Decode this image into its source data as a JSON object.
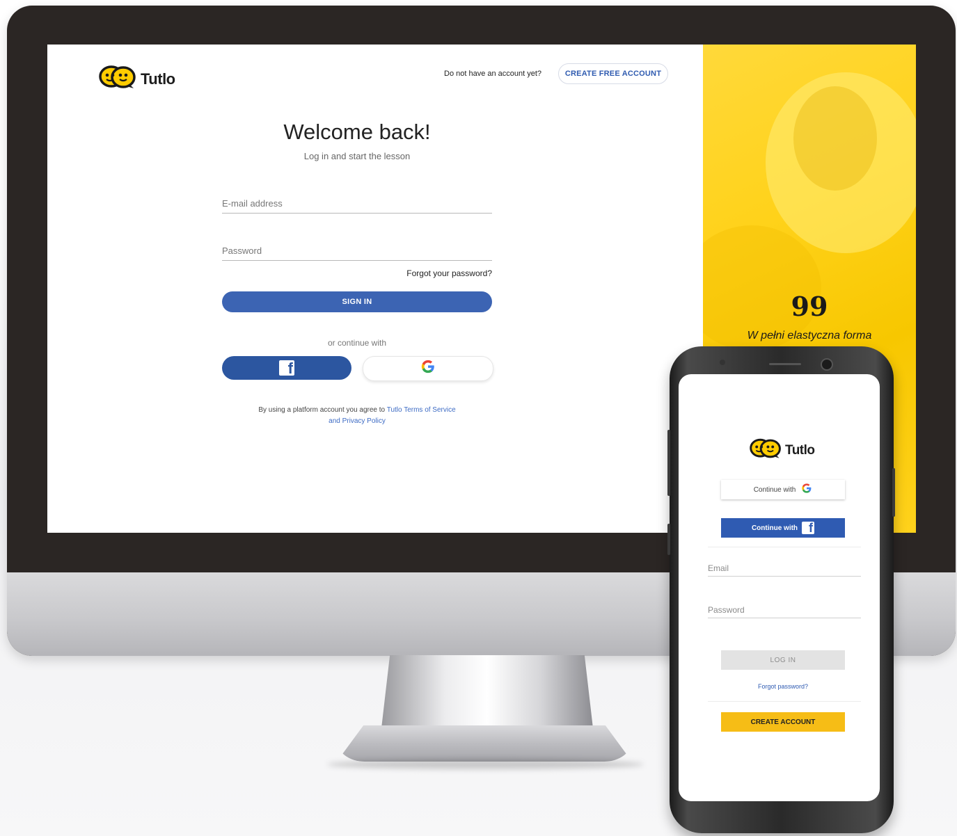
{
  "desktop": {
    "logo_text": "Tutlo",
    "header": {
      "no_account_text": "Do not have an account yet?",
      "create_account_label": "CREATE FREE ACCOUNT"
    },
    "title": "Welcome back!",
    "subtitle": "Log in and start the lesson",
    "email_placeholder": "E-mail address",
    "password_placeholder": "Password",
    "forgot_label": "Forgot your password?",
    "signin_label": "SIGN IN",
    "or_text": "or continue with",
    "terms_prefix": "By using a platform account you agree to",
    "terms_link": "Tutlo Terms of Service",
    "terms_and": "and",
    "privacy_link": "Privacy Policy",
    "side_panel": {
      "quote_mark": "99",
      "quote_text": "W pełni elastyczna forma"
    }
  },
  "mobile": {
    "logo_text": "Tutlo",
    "google_label": "Continue with",
    "facebook_label": "Continue with",
    "email_placeholder": "Email",
    "password_placeholder": "Password",
    "login_label": "LOG IN",
    "forgot_label": "Forgot password?",
    "create_label": "CREATE ACCOUNT"
  },
  "icons": {
    "facebook": "facebook-icon",
    "google": "google-icon",
    "logo": "tutlo-logo-icon"
  },
  "colors": {
    "brand_yellow": "#ffd21a",
    "primary_blue": "#3c64b3",
    "facebook_blue": "#2c56a0",
    "create_yellow": "#f6bd16"
  }
}
